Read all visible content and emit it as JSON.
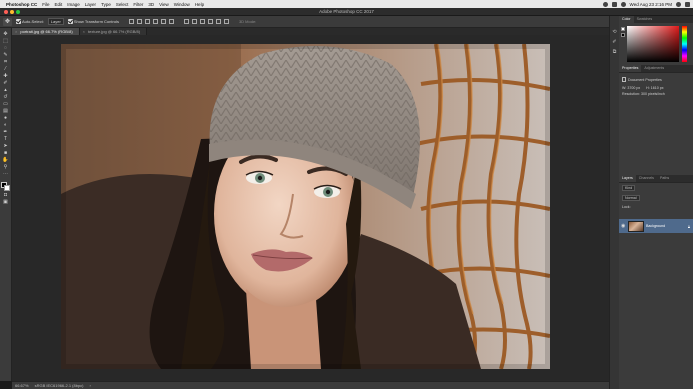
{
  "menubar": {
    "app_name": "Photoshop CC",
    "items": [
      "File",
      "Edit",
      "Image",
      "Layer",
      "Type",
      "Select",
      "Filter",
      "3D",
      "View",
      "Window",
      "Help"
    ],
    "clock": "Wed Aug 23  2:16 PM"
  },
  "window": {
    "title": "Adobe Photoshop CC 2017"
  },
  "options": {
    "auto_select_label": "Auto-Select:",
    "auto_select_value": "Layer",
    "transform_controls_label": "Show Transform Controls",
    "mode_3d_label": "3D Mode:"
  },
  "tabs": [
    {
      "label": "portrait.jpg @ 66.7% (RGB/8)",
      "active": true
    },
    {
      "label": "texture.jpg @ 66.7% (RGB/8)",
      "active": false
    }
  ],
  "panels": {
    "color_tabs": [
      "Color",
      "Swatches"
    ],
    "properties_tabs": [
      "Properties",
      "Adjustments"
    ],
    "properties_heading": "Document Properties",
    "width": "W: 3700 px",
    "height": "H: 1610 px",
    "resolution": "Resolution: 300 pixels/inch",
    "layers_tabs": [
      "Layers",
      "Channels",
      "Paths"
    ],
    "kind_label": "Kind",
    "blend_mode": "Normal",
    "lock_label": "Lock:",
    "layer_name": "Background"
  },
  "status": {
    "zoom": "66.67%",
    "doc_info": "sRGB IEC61966-2.1 (8bpc)"
  },
  "colors": {
    "close": "#ff5f57",
    "minimize": "#febc2e",
    "zoom": "#28c840",
    "selected_layer": "#4f6a8c"
  }
}
